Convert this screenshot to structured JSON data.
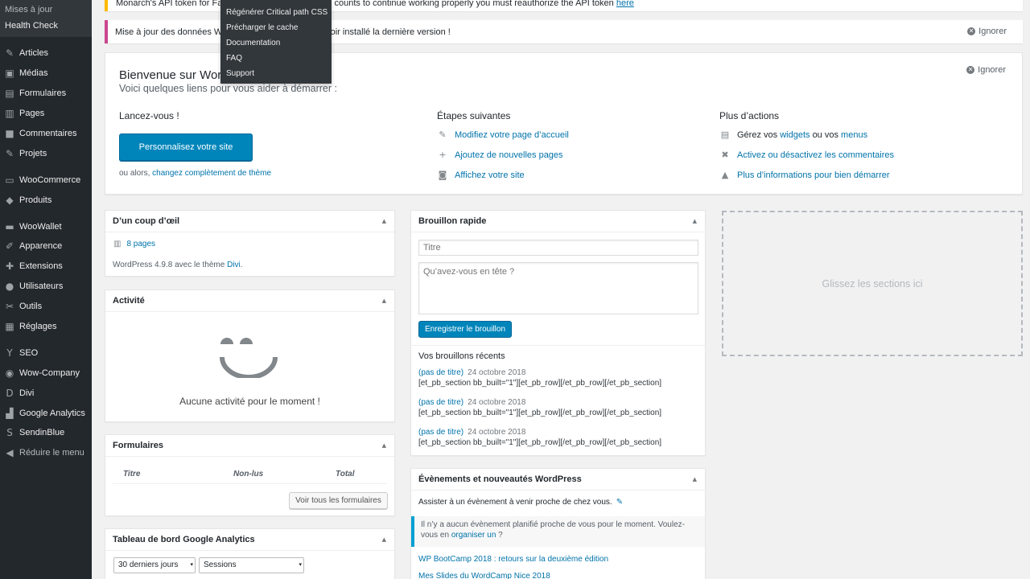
{
  "sidebar": {
    "submenu": [
      {
        "label": "Mises à jour"
      },
      {
        "label": "Health Check"
      }
    ],
    "groups": [
      [
        {
          "label": "Articles",
          "icon": "pin-icon",
          "glyph": "✎"
        },
        {
          "label": "Médias",
          "icon": "media-icon",
          "glyph": "▣"
        },
        {
          "label": "Formulaires",
          "icon": "forms-icon",
          "glyph": "▤"
        },
        {
          "label": "Pages",
          "icon": "pages-icon",
          "glyph": "▥"
        },
        {
          "label": "Commentaires",
          "icon": "comments-icon",
          "glyph": "■"
        },
        {
          "label": "Projets",
          "icon": "projects-pin-icon",
          "glyph": "✎"
        }
      ],
      [
        {
          "label": "WooCommerce",
          "icon": "woocommerce-icon",
          "glyph": "▭"
        },
        {
          "label": "Produits",
          "icon": "products-icon",
          "glyph": "◆"
        }
      ],
      [
        {
          "label": "WooWallet",
          "icon": "wallet-icon",
          "glyph": "▬"
        },
        {
          "label": "Apparence",
          "icon": "appearance-brush-icon",
          "glyph": "✐"
        },
        {
          "label": "Extensions",
          "icon": "plugins-icon",
          "glyph": "✚"
        },
        {
          "label": "Utilisateurs",
          "icon": "users-icon",
          "glyph": "●"
        },
        {
          "label": "Outils",
          "icon": "tools-icon",
          "glyph": "✂"
        },
        {
          "label": "Réglages",
          "icon": "settings-icon",
          "glyph": "▦"
        }
      ],
      [
        {
          "label": "SEO",
          "icon": "yoast-seo-icon",
          "glyph": "Y"
        },
        {
          "label": "Wow-Company",
          "icon": "wow-company-icon",
          "glyph": "◉"
        },
        {
          "label": "Divi",
          "icon": "divi-icon",
          "glyph": "D"
        },
        {
          "label": "Google Analytics",
          "icon": "analytics-icon",
          "glyph": "▟"
        },
        {
          "label": "SendinBlue",
          "icon": "sendinblue-icon",
          "glyph": "S"
        },
        {
          "label": "Réduire le menu",
          "icon": "collapse-icon",
          "glyph": "◀"
        }
      ]
    ]
  },
  "dropdown": {
    "items": [
      "Régénérer Critical path CSS",
      "Précharger le cache",
      "Documentation",
      "FAQ",
      "Support"
    ]
  },
  "notices": {
    "top_text": "Monarch's API token for Face",
    "top_text_2": "or your follow and share counts to continue working properly you must reauthorize the API token",
    "top_link": "here",
    "maj_text": "Mise à jour des données Woo",
    "maj_text_2": "avoir installé la dernière version !",
    "dismiss_label": "Ignorer"
  },
  "welcome": {
    "title": "Bienvenue sur Word",
    "subtitle": "Voici quelques liens pour vous aider à démarrer :",
    "dismiss_label": "Ignorer",
    "col1_title": "Lancez-vous !",
    "customize_button": "Personnalisez votre site",
    "or_text": "ou alors,",
    "change_theme_link": "changez complètement de thème",
    "col2_title": "Étapes suivantes",
    "next_steps": [
      {
        "label": "Modifiez votre page d’accueil",
        "icon": "edit-page-icon",
        "glyph": "✎"
      },
      {
        "label": "Ajoutez de nouvelles pages",
        "icon": "plus-icon",
        "glyph": "+"
      },
      {
        "label": "Affichez votre site",
        "icon": "view-site-icon",
        "glyph": "◙"
      }
    ],
    "col3_title": "Plus d’actions",
    "more_actions": {
      "manage_prefix": "Gérez vos",
      "widgets_link": "widgets",
      "manage_middle": "ou vos",
      "menus_link": "menus",
      "comments_link": "Activez ou désactivez les commentaires",
      "learn_more_link": "Plus d’informations pour bien démarrer"
    }
  },
  "glance": {
    "title": "D’un coup d’œil",
    "pages_link": "8 pages",
    "wp_version_text": "WordPress 4.9.8 avec le thème",
    "theme_link": "Divi",
    "period": "."
  },
  "activity": {
    "title": "Activité",
    "empty_text": "Aucune activité pour le moment !"
  },
  "forms": {
    "title": "Formulaires",
    "columns": [
      "Titre",
      "Non-lus",
      "Total"
    ],
    "view_all_button": "Voir tous les formulaires"
  },
  "analytics": {
    "title": "Tableau de bord Google Analytics",
    "period_select": "30 derniers jours",
    "metric_select": "Sessions"
  },
  "quick_draft": {
    "title": "Brouillon rapide",
    "title_placeholder": "Titre",
    "content_placeholder": "Qu’avez-vous en tête ?",
    "save_button": "Enregistrer le brouillon",
    "recent_title": "Vos brouillons récents",
    "drafts": [
      {
        "title": "(pas de titre)",
        "date": "24 octobre 2018",
        "excerpt": "[et_pb_section bb_built=\"1\"][et_pb_row][/et_pb_row][/et_pb_section]"
      },
      {
        "title": "(pas de titre)",
        "date": "24 octobre 2018",
        "excerpt": "[et_pb_section bb_built=\"1\"][et_pb_row][/et_pb_row][/et_pb_section]"
      },
      {
        "title": "(pas de titre)",
        "date": "24 octobre 2018",
        "excerpt": "[et_pb_section bb_built=\"1\"][et_pb_row][/et_pb_row][/et_pb_section]"
      }
    ]
  },
  "events": {
    "title": "Évènements et nouveautés WordPress",
    "attend_text": "Assister à un évènement à venir proche de chez vous.",
    "no_event_text": "Il n’y a aucun évènement planifié proche de vous pour le moment. Voulez-vous en",
    "organize_link": "organiser un",
    "no_event_suffix": " ?",
    "news": [
      "WP BootCamp 2018 : retours sur la deuxième édition",
      "Mes Slides du WordCamp Nice 2018"
    ]
  },
  "dropzone": {
    "label": "Glissez les sections ici"
  }
}
